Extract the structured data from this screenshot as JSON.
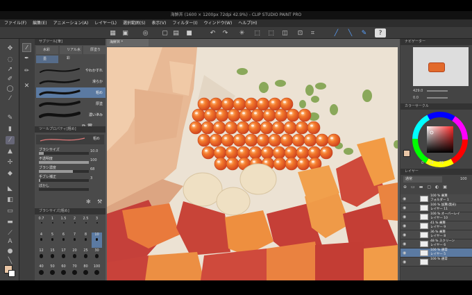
{
  "window": {
    "title": "海鮮丼 (1600 × 1200px 72dpi 42.9%) - CLIP STUDIO PAINT PRO"
  },
  "menu": [
    "ファイル(F)",
    "編集(E)",
    "アニメーション(A)",
    "レイヤー(L)",
    "選択範囲(S)",
    "表示(V)",
    "フィルター(I)",
    "ウィンドウ(W)",
    "ヘルプ(H)"
  ],
  "subtool": {
    "header": "サブツール[筆]",
    "tabs": [
      "水彩",
      "リアル水彩",
      "厚塗り"
    ],
    "group": "墨",
    "brushes": [
      "やわかすれ",
      "滑らか",
      "粗め",
      "厚塗",
      "濃い滲み"
    ],
    "selected_index": 2
  },
  "tool_property": {
    "header": "ツールプロパティ[粗め]",
    "title": "粗め",
    "rows": [
      {
        "label": "ブラシサイズ",
        "value": "10.0",
        "level": 0.1
      },
      {
        "label": "不透明度",
        "value": "100",
        "level": 1.0
      },
      {
        "label": "ブラシ濃度",
        "value": "68",
        "level": 0.68
      },
      {
        "label": "手ブレ補正",
        "value": "3",
        "level": 0.03
      },
      {
        "label": "ぼかし",
        "value": "",
        "level": 0
      }
    ]
  },
  "brush_size": {
    "header": "ブラシサイズ[粗め]",
    "values": [
      "0.7",
      "1",
      "1.5",
      "2",
      "2.5",
      "3",
      "4",
      "5",
      "6",
      "7",
      "8",
      "10",
      "12",
      "15",
      "17",
      "20",
      "25",
      "30",
      "40",
      "50",
      "60",
      "70",
      "80",
      "100"
    ]
  },
  "canvas": {
    "tab": "海鮮丼 *"
  },
  "navigator": {
    "header": "ナビゲーター",
    "zoom": "429.0",
    "rotation": "0.0"
  },
  "color_circle": {
    "header": "カラーサークル",
    "h": "0",
    "s": "18",
    "v": "79"
  },
  "layers": {
    "header": "レイヤー",
    "blend_mode": "通常",
    "opacity": "100",
    "items": [
      {
        "name": "100 % 乗算\nフォルダー 1",
        "selected": false
      },
      {
        "name": "100 % 加算(発光)\nレイヤー 11",
        "selected": false
      },
      {
        "name": "100 % オーバーレイ\nレイヤー 10",
        "selected": false
      },
      {
        "name": "41 % 乗算\nレイヤー 9",
        "selected": false
      },
      {
        "name": "36 % 乗算\nレイヤー 8",
        "selected": false
      },
      {
        "name": "48 % スクリーン\nレイヤー 6",
        "selected": false
      },
      {
        "name": "100 % 通常\nレイヤー 5",
        "selected": true
      },
      {
        "name": "100 % 通常",
        "selected": false
      }
    ]
  },
  "colors": {
    "main": "#e9c6a6",
    "sub": "#f0d9b8",
    "accent": "#f08a24"
  }
}
